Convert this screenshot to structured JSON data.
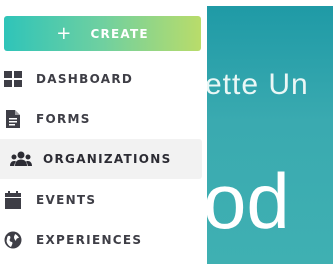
{
  "create_button": {
    "label": "CREATE",
    "icon": "plus-icon"
  },
  "nav": {
    "items": [
      {
        "label": "DASHBOARD",
        "icon": "dashboard-grid-icon"
      },
      {
        "label": "FORMS",
        "icon": "document-icon"
      },
      {
        "label": "ORGANIZATIONS",
        "icon": "users-group-icon",
        "active": true
      },
      {
        "label": "EVENTS",
        "icon": "calendar-icon"
      },
      {
        "label": "EXPERIENCES",
        "icon": "globe-icon"
      }
    ]
  },
  "hero": {
    "line1": "ette Un",
    "line2": "od"
  },
  "colors": {
    "accent_start": "#2fc4b9",
    "accent_end": "#b9dc6a",
    "hero_teal": "#3aaab0",
    "nav_text": "#3e3e46",
    "active_bg": "#f2f2f2"
  }
}
